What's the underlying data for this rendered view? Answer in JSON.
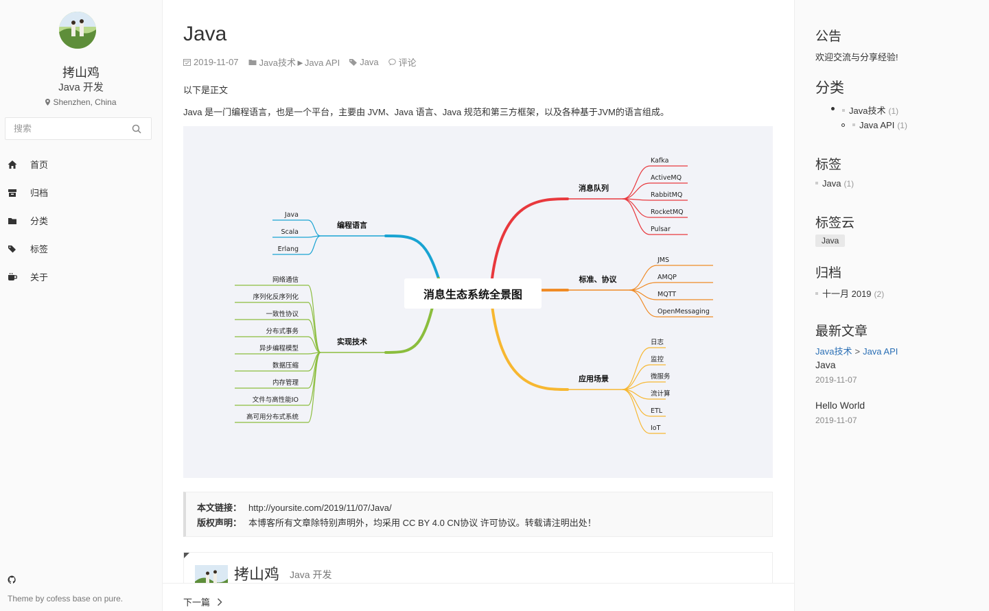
{
  "left": {
    "author_name": "拷山鸡",
    "author_job": "Java 开发",
    "location": "Shenzhen, China",
    "search_placeholder": "搜索",
    "nav": [
      {
        "label": "首页",
        "icon": "home-icon"
      },
      {
        "label": "归档",
        "icon": "archive-icon"
      },
      {
        "label": "分类",
        "icon": "folder-icon"
      },
      {
        "label": "标签",
        "icon": "tags-icon"
      },
      {
        "label": "关于",
        "icon": "coffee-icon"
      }
    ],
    "footer_text": "Theme by cofess base on pure."
  },
  "post": {
    "title": "Java",
    "date": "2019-11-07",
    "category": "Java技术►Java API",
    "tag": "Java",
    "comments": "评论",
    "p1": "以下是正文",
    "p2": "Java 是一门编程语言，也是一个平台，主要由 JVM、Java 语言、Java 规范和第三方框架，以及各种基于JVM的语言组成。",
    "mindmap": {
      "center": "消息生态系统全景图",
      "branches": [
        {
          "title": "编程语言",
          "color": "#19a3d2",
          "items": [
            "Java",
            "Scala",
            "Erlang"
          ]
        },
        {
          "title": "实现技术",
          "color": "#8bbd3d",
          "items": [
            "网络通信",
            "序列化反序列化",
            "一致性协议",
            "分布式事务",
            "异步编程模型",
            "数据压缩",
            "内存管理",
            "文件与高性能IO",
            "高可用分布式系统"
          ]
        },
        {
          "title": "消息队列",
          "color": "#e8383d",
          "items": [
            "Kafka",
            "ActiveMQ",
            "RabbitMQ",
            "RocketMQ",
            "Pulsar"
          ]
        },
        {
          "title": "标准、协议",
          "color": "#f08a24",
          "items": [
            "JMS",
            "AMQP",
            "MQTT",
            "OpenMessaging"
          ]
        },
        {
          "title": "应用场景",
          "color": "#f7b731",
          "items": [
            "日志",
            "监控",
            "微服务",
            "流计算",
            "ETL",
            "IoT"
          ]
        }
      ]
    },
    "copyright": {
      "link_label": "本文链接：",
      "link_value": "http://yoursite.com/2019/11/07/Java/",
      "license_label": "版权声明：",
      "license_value": "本博客所有文章除特别声明外，均采用 CC BY 4.0 CN协议 许可协议。转载请注明出处！"
    },
    "author_card": {
      "name": "拷山鸡",
      "job": "Java 开发"
    },
    "next_label": "下一篇"
  },
  "right": {
    "notice_title": "公告",
    "notice_text": "欢迎交流与分享经验!",
    "categories_title": "分类",
    "categories": [
      {
        "name": "Java技术",
        "count": "(1)"
      },
      {
        "name": "Java API",
        "count": "(1)"
      }
    ],
    "tags_title": "标签",
    "tags": [
      {
        "name": "Java",
        "count": "(1)"
      }
    ],
    "tagcloud_title": "标签云",
    "tagcloud": [
      "Java"
    ],
    "archive_title": "归档",
    "archives": [
      {
        "name": "十一月 2019",
        "count": "(2)"
      }
    ],
    "recent_title": "最新文章",
    "recent": [
      {
        "cat1": "Java技术",
        "cat2": "Java API",
        "title": "Java",
        "date": "2019-11-07"
      },
      {
        "title": "Hello World",
        "date": "2019-11-07"
      }
    ]
  }
}
